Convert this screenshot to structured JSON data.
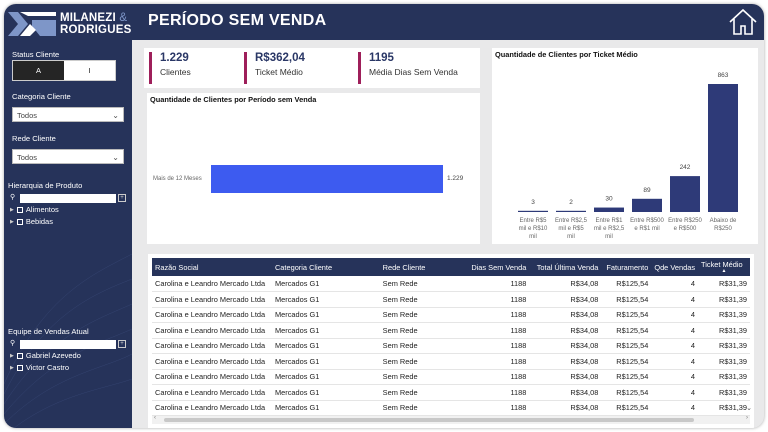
{
  "brand": {
    "line1": "MILANEZI",
    "amp": "&",
    "line2": "RODRIGUES"
  },
  "header": {
    "title": "PERÍODO SEM VENDA",
    "home_icon": "home-icon"
  },
  "sidebar": {
    "status_label": "Status Cliente",
    "status_options": [
      "A",
      "I"
    ],
    "categoria_label": "Categoria Cliente",
    "categoria_value": "Todos",
    "rede_label": "Rede Cliente",
    "rede_value": "Todos",
    "hierarquia_label": "Hierarquia de Produto",
    "hierarquia_items": [
      "Alimentos",
      "Bebidas"
    ],
    "equipe_label": "Equipe de Vendas Atual",
    "equipe_items": [
      "Gabriel Azevedo",
      "Victor Castro"
    ]
  },
  "kpis": [
    {
      "value": "1.229",
      "label": "Clientes"
    },
    {
      "value": "R$362,04",
      "label": "Ticket Médio"
    },
    {
      "value": "1195",
      "label": "Média Dias Sem Venda"
    }
  ],
  "colors": {
    "navy": "#26335a",
    "bar_blue": "#3d5bf0",
    "bar_navy": "#2e3a78",
    "kpi_accent": "#9e1f5a"
  },
  "chart_data": [
    {
      "type": "bar",
      "orientation": "horizontal",
      "title": "Quantidade de Clientes por Período sem Venda",
      "categories": [
        "Mais de 12 Meses"
      ],
      "values": [
        1229
      ],
      "value_labels": [
        "1.229"
      ]
    },
    {
      "type": "bar",
      "title": "Quantidade de Clientes por Ticket Médio",
      "categories": [
        "Entre R$5 mil e R$10 mil",
        "Entre R$2,5 mil e R$5 mil",
        "Entre R$1 mil e R$2,5 mil",
        "Entre R$500 e R$1 mil",
        "Entre R$250 e R$500",
        "Abaixo de R$250"
      ],
      "category_lines": [
        [
          "Entre R$5",
          "mil e R$10",
          "mil"
        ],
        [
          "Entre R$2,5",
          "mil e R$5",
          "mil"
        ],
        [
          "Entre R$1",
          "mil e R$2,5",
          "mil"
        ],
        [
          "Entre R$500",
          "e R$1 mil"
        ],
        [
          "Entre R$250",
          "e R$500"
        ],
        [
          "Abaixo de",
          "R$250"
        ]
      ],
      "values": [
        3,
        2,
        30,
        89,
        242,
        863
      ]
    }
  ],
  "table": {
    "columns": [
      "Razão Social",
      "Categoria Cliente",
      "Rede Cliente",
      "Dias Sem Venda",
      "Total Última Venda",
      "Faturamento",
      "Qde Vendas",
      "Ticket Médio"
    ],
    "rows": [
      [
        "Carolina e Leandro Mercado Ltda",
        "Mercados G1",
        "Sem Rede",
        "1188",
        "R$34,08",
        "R$125,54",
        "4",
        "R$31,39"
      ],
      [
        "Carolina e Leandro Mercado Ltda",
        "Mercados G1",
        "Sem Rede",
        "1188",
        "R$34,08",
        "R$125,54",
        "4",
        "R$31,39"
      ],
      [
        "Carolina e Leandro Mercado Ltda",
        "Mercados G1",
        "Sem Rede",
        "1188",
        "R$34,08",
        "R$125,54",
        "4",
        "R$31,39"
      ],
      [
        "Carolina e Leandro Mercado Ltda",
        "Mercados G1",
        "Sem Rede",
        "1188",
        "R$34,08",
        "R$125,54",
        "4",
        "R$31,39"
      ],
      [
        "Carolina e Leandro Mercado Ltda",
        "Mercados G1",
        "Sem Rede",
        "1188",
        "R$34,08",
        "R$125,54",
        "4",
        "R$31,39"
      ],
      [
        "Carolina e Leandro Mercado Ltda",
        "Mercados G1",
        "Sem Rede",
        "1188",
        "R$34,08",
        "R$125,54",
        "4",
        "R$31,39"
      ],
      [
        "Carolina e Leandro Mercado Ltda",
        "Mercados G1",
        "Sem Rede",
        "1188",
        "R$34,08",
        "R$125,54",
        "4",
        "R$31,39"
      ],
      [
        "Carolina e Leandro Mercado Ltda",
        "Mercados G1",
        "Sem Rede",
        "1188",
        "R$34,08",
        "R$125,54",
        "4",
        "R$31,39"
      ],
      [
        "Carolina e Leandro Mercado Ltda",
        "Mercados G1",
        "Sem Rede",
        "1188",
        "R$34,08",
        "R$125,54",
        "4",
        "R$31,39"
      ]
    ]
  }
}
